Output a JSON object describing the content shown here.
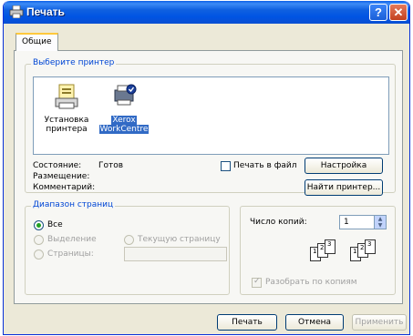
{
  "window": {
    "title": "Печать"
  },
  "tabs": [
    {
      "label": "Общие"
    }
  ],
  "printer_section": {
    "legend": "Выберите принтер",
    "printers": [
      {
        "label_line1": "Установка",
        "label_line2": "принтера"
      },
      {
        "label_line1": "Xerox",
        "label_line2": "WorkCentre"
      }
    ]
  },
  "status": {
    "state_label": "Состояние:",
    "state_value": "Готов",
    "location_label": "Размещение:",
    "comment_label": "Комментарий:"
  },
  "print_to_file": {
    "label": "Печать в файл",
    "checked": false
  },
  "buttons": {
    "settings": "Настройка",
    "find_printer": "Найти принтер...",
    "print": "Печать",
    "cancel": "Отмена",
    "apply": "Применить"
  },
  "page_range": {
    "legend": "Диапазон страниц",
    "all": "Все",
    "selection": "Выделение",
    "current_page": "Текущую страницу",
    "pages": "Страницы:",
    "pages_value": ""
  },
  "copies": {
    "label": "Число копий:",
    "value": "1",
    "collate_label": "Разобрать по копиям",
    "collate_checked": true
  },
  "colors": {
    "title_bar": "#0054e3",
    "accent_label": "#0046d5",
    "selection": "#316ac5",
    "tab_highlight": "#ffc83c"
  }
}
